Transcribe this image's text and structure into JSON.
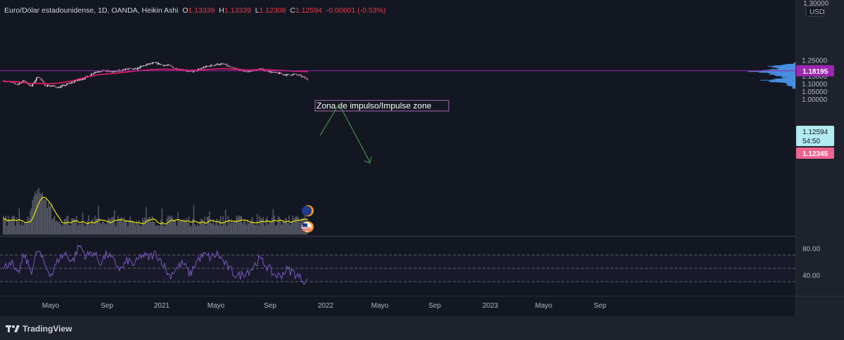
{
  "header": {
    "symbol": "Euro/Dólar estadounidense, 1D, OANDA, Heikin Ashi",
    "open_label": "O",
    "open": "1.13339",
    "high_label": "H",
    "high": "1.13339",
    "low_label": "L",
    "low": "1.12308",
    "close_label": "C",
    "close": "1.12594",
    "change": "-0.00601 (-0.53%)"
  },
  "price_axis": {
    "currency": "USD",
    "top_label": "1.30000",
    "ticks": [
      "1.25000",
      "1.20000",
      "1.15000",
      "1.10000",
      "1.05000",
      "1.00000"
    ],
    "level_label": "1.18195",
    "last_price": "1.12594",
    "countdown": "54:50",
    "prev_label": "1.12345"
  },
  "rsi_axis": {
    "ticks": [
      "80.00",
      "40.00"
    ]
  },
  "time_axis": [
    "Mayo",
    "Sep",
    "2021",
    "Mayo",
    "Sep",
    "2022",
    "Mayo",
    "Sep",
    "2023",
    "Mayo",
    "Sep"
  ],
  "annotation": {
    "text": "Zona de impulso/Impulse zone"
  },
  "footer": {
    "brand": "TradingView",
    "logo": "tradingview-logo-icon"
  },
  "colors": {
    "background": "#131722",
    "candle": "#ffffff",
    "candle_down": "#e57ca1",
    "ma": "#e91e63",
    "level_line": "#9c27b0",
    "volume_profile": "#4a90e2",
    "volume_ma": "#e6e600",
    "rsi": "#7e57c2",
    "arrow": "#3d7a46"
  },
  "chart_data": [
    {
      "type": "line",
      "title": "Euro/Dólar estadounidense, 1D, OANDA, Heikin Ashi",
      "series": [
        {
          "values": [
            1.12,
            1.108,
            1.095,
            1.12,
            1.08,
            1.15,
            1.09,
            1.085,
            1.075,
            1.092,
            1.11,
            1.125,
            1.14,
            1.17,
            1.183,
            1.18,
            1.175,
            1.185,
            1.195,
            1.19,
            1.21,
            1.225,
            1.232,
            1.22,
            1.215,
            1.195,
            1.188,
            1.175,
            1.185,
            1.205,
            1.215,
            1.225,
            1.223,
            1.2,
            1.19,
            1.178,
            1.182,
            1.193,
            1.185,
            1.17,
            1.165,
            1.155,
            1.16,
            1.15,
            1.126
          ]
        },
        {
          "values": [
            1.117,
            1.113,
            1.112,
            1.108,
            1.1,
            1.102,
            1.098,
            1.1,
            1.103,
            1.11,
            1.117,
            1.13,
            1.14,
            1.15,
            1.158,
            1.162,
            1.165,
            1.17,
            1.175,
            1.18,
            1.184,
            1.188,
            1.191,
            1.192,
            1.192,
            1.19,
            1.188,
            1.186,
            1.187,
            1.189,
            1.192,
            1.195,
            1.196,
            1.193,
            1.19,
            1.188,
            1.188,
            1.19,
            1.189,
            1.187,
            1.185,
            1.182,
            1.18,
            1.178,
            1.176
          ]
        }
      ],
      "levels": [
        1.18195
      ],
      "ylim": [
        0.98,
        1.31
      ]
    },
    {
      "type": "line",
      "series": [
        {
          "values": [
            48,
            62,
            38,
            70,
            45,
            78,
            55,
            40,
            65,
            72,
            60,
            85,
            68,
            75,
            58,
            72,
            60,
            48,
            62,
            55,
            70,
            66,
            72,
            60,
            38,
            50,
            58,
            40,
            62,
            70,
            66,
            72,
            58,
            45,
            38,
            44,
            50,
            64,
            55,
            42,
            38,
            48,
            44,
            35,
            30
          ]
        }
      ],
      "levels": [
        70,
        50,
        30
      ],
      "ylim": [
        15,
        100
      ]
    }
  ]
}
